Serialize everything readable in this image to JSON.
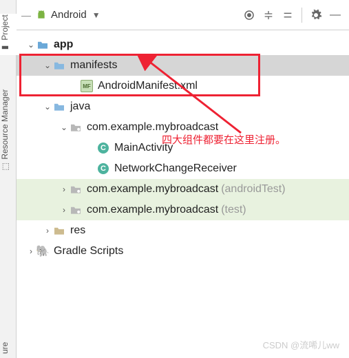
{
  "sidebar": {
    "project": "Project",
    "resmgr": "Resource Manager",
    "bottom": "ure"
  },
  "toolbar": {
    "view": "Android",
    "minimize": "—"
  },
  "tree": {
    "app": "app",
    "manifests": "manifests",
    "manifest_file": "AndroidManifest.xml",
    "java": "java",
    "pkg_main": "com.example.mybroadcast",
    "main_activity": "MainActivity",
    "network_receiver": "NetworkChangeReceiver",
    "pkg_atest": "com.example.mybroadcast",
    "pkg_atest_suffix": "(androidTest)",
    "pkg_test": "com.example.mybroadcast",
    "pkg_test_suffix": "(test)",
    "res": "res",
    "gradle": "Gradle Scripts"
  },
  "annotation": "四大组件都要在这里注册。",
  "watermark": "CSDN @流唏儿ww"
}
